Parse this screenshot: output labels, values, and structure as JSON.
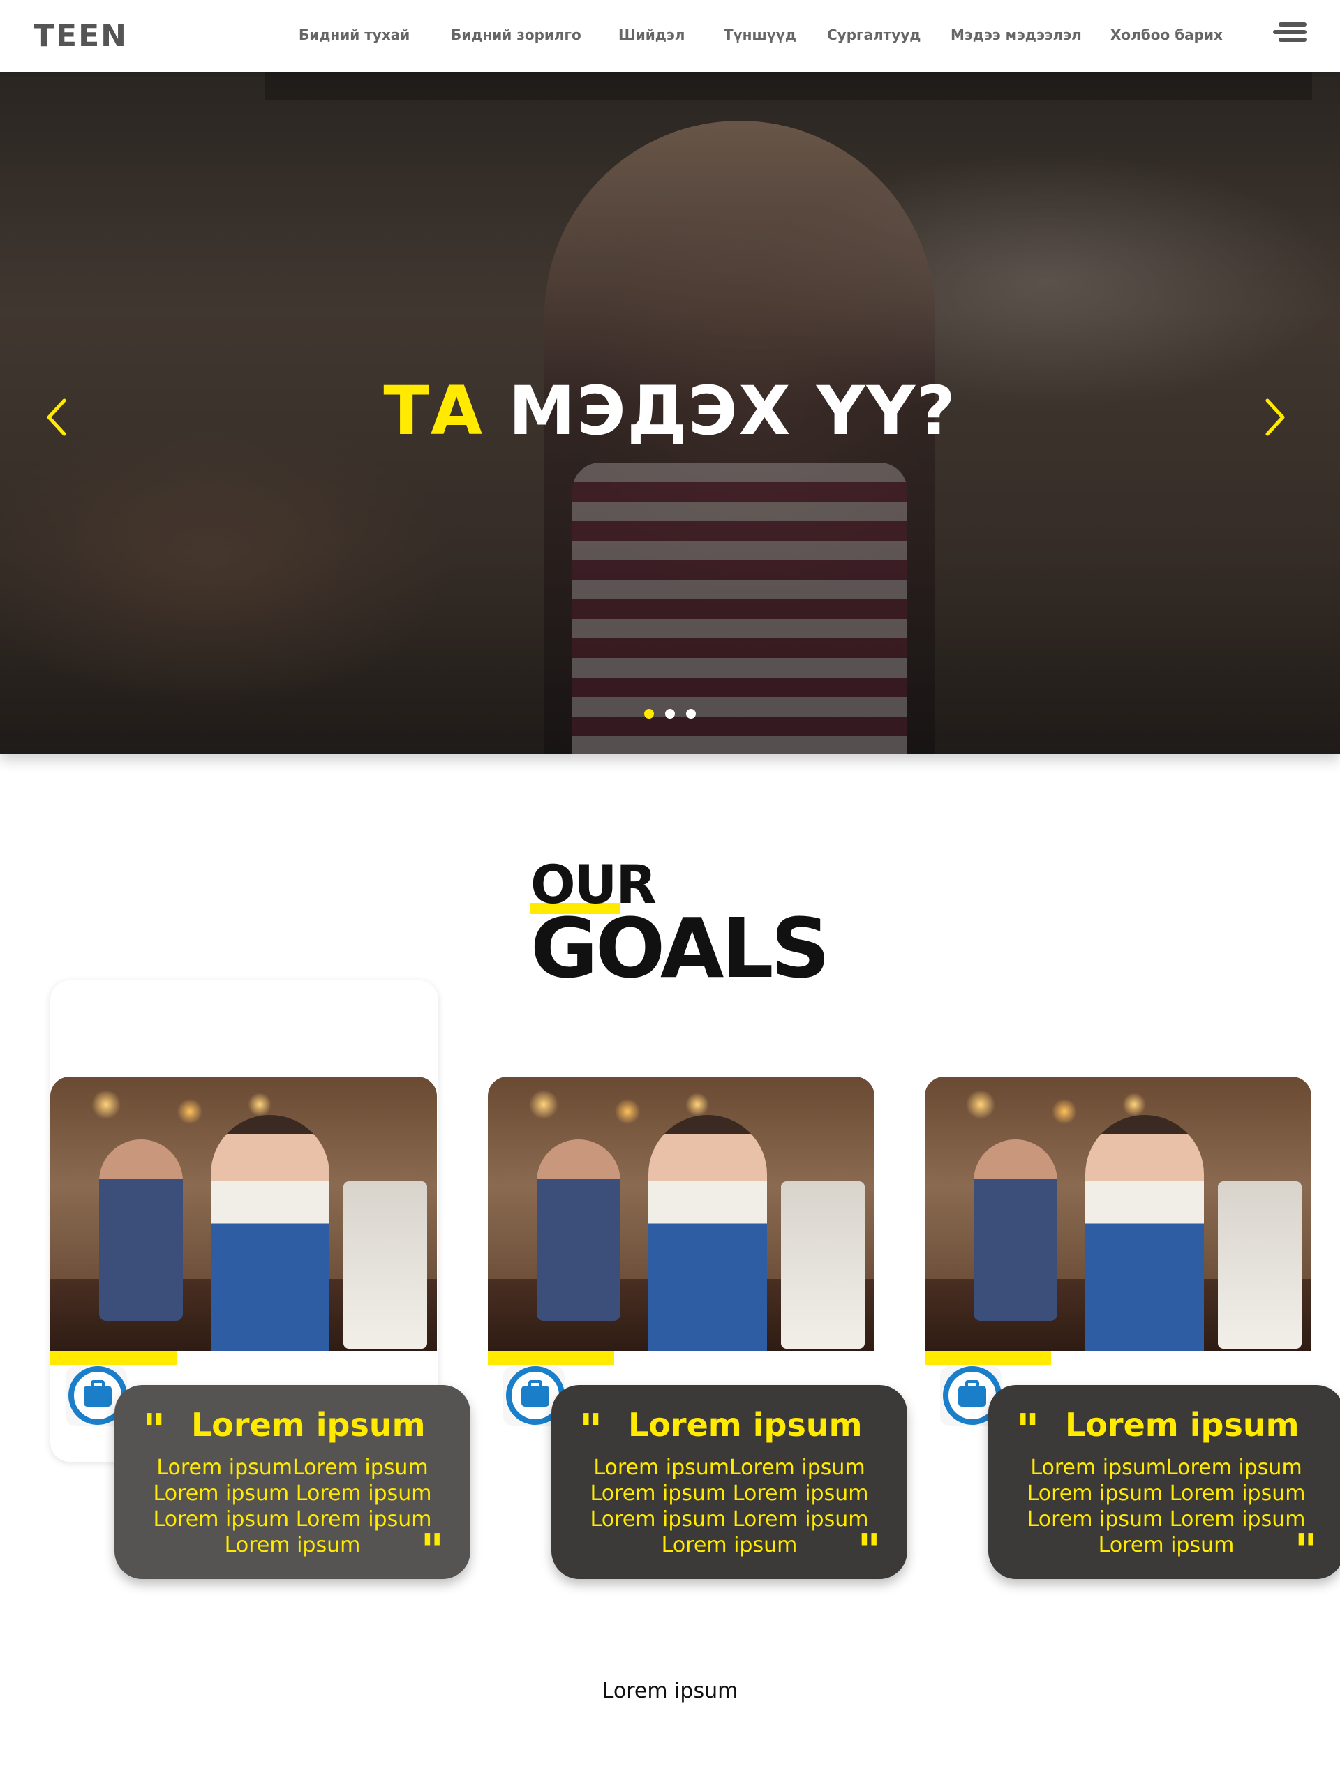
{
  "header": {
    "logo": "TEEN",
    "nav": [
      "Бидний тухай",
      "Бидний зорилго",
      "Шийдэл",
      "Түншүүд",
      "Сургалтууд",
      "Мэдээ мэдээлэл",
      "Холбоо барих"
    ]
  },
  "hero": {
    "title_highlight": "ТА",
    "title_rest": "МЭДЭХ ҮҮ?",
    "slides": 3,
    "active_slide": 1,
    "highlight_color": "#ffea00"
  },
  "goals": {
    "title_top": "OUR",
    "title_bottom": "GOALS",
    "cards": [
      {
        "title": "Lorem ipsum",
        "lines": [
          "Lorem ipsumLorem ipsum",
          "Lorem ipsum Lorem ipsum",
          "Lorem ipsum Lorem ipsum",
          "Lorem ipsum"
        ],
        "icon": "briefcase-icon"
      },
      {
        "title": "Lorem ipsum",
        "lines": [
          "Lorem ipsumLorem ipsum",
          "Lorem ipsum Lorem ipsum",
          "Lorem ipsum Lorem ipsum",
          "Lorem ipsum"
        ],
        "icon": "briefcase-icon"
      },
      {
        "title": "Lorem ipsum",
        "lines": [
          "Lorem ipsumLorem ipsum",
          "Lorem ipsum Lorem ipsum",
          "Lorem ipsum Lorem ipsum",
          "Lorem ipsum"
        ],
        "icon": "briefcase-icon"
      }
    ]
  },
  "footer": {
    "text": "Lorem ipsum"
  },
  "colors": {
    "accent": "#ffea00",
    "icon_blue": "#1a7ec8",
    "quote_bg": "#3b3a38"
  }
}
